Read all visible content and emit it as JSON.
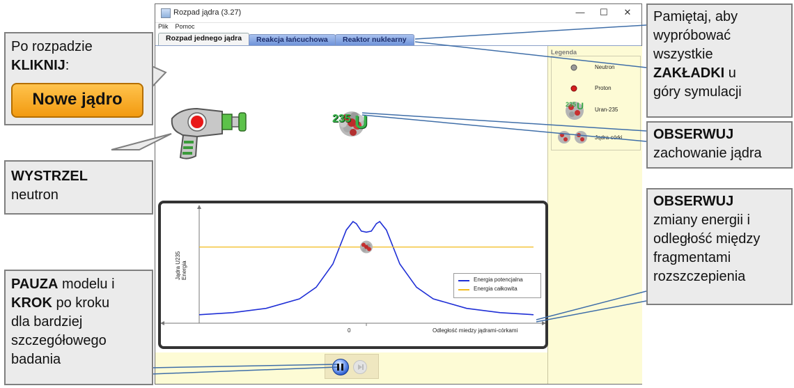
{
  "window": {
    "title": "Rozpad jądra (3.27)",
    "minimize": "—",
    "maximize": "☐",
    "close": "✕"
  },
  "menu": [
    "Plik",
    "Pomoc"
  ],
  "tabs": [
    {
      "label": "Rozpad jednego jądra",
      "active": true
    },
    {
      "label": "Reakcja łańcuchowa",
      "active": false
    },
    {
      "label": "Reaktor nuklearny",
      "active": false
    }
  ],
  "legend": {
    "title": "Legenda",
    "items": [
      {
        "label": "Neutron",
        "icon": "neutron-icon"
      },
      {
        "label": "Proton",
        "icon": "proton-icon"
      },
      {
        "label": "Uran-235",
        "icon": "uranium-icon"
      },
      {
        "label": "Jądra-córki",
        "icon": "daughter-nuclei-icon"
      }
    ]
  },
  "nucleus": {
    "label": "235U",
    "number": "235",
    "symbol": "U"
  },
  "chart_data": {
    "type": "line",
    "xlabel": "Odległość miedzy jądrami-córkami",
    "ylabel_line1": "Jądra U235",
    "ylabel_line2": "Energia",
    "xtick": "0",
    "xlim": [
      -1,
      1
    ],
    "ylim": [
      0,
      1
    ],
    "series": [
      {
        "name": "Energia potencjalna",
        "color": "#1f2fd6",
        "x": [
          -1,
          -0.8,
          -0.6,
          -0.4,
          -0.3,
          -0.2,
          -0.12,
          -0.08,
          -0.06,
          -0.03,
          0,
          0.03,
          0.06,
          0.08,
          0.12,
          0.2,
          0.3,
          0.4,
          0.6,
          0.8,
          1
        ],
        "y": [
          0.08,
          0.1,
          0.14,
          0.23,
          0.34,
          0.56,
          0.88,
          0.96,
          0.94,
          0.87,
          0.86,
          0.87,
          0.94,
          0.96,
          0.88,
          0.56,
          0.34,
          0.23,
          0.14,
          0.1,
          0.08
        ]
      },
      {
        "name": "Energia całkowita",
        "color": "#f2bb1c",
        "x": [
          -1,
          1
        ],
        "y": [
          0.72,
          0.72
        ]
      }
    ],
    "legend_position": "right"
  },
  "callouts": {
    "new_nucleus": {
      "line1": "Po rozpadzie",
      "strong": "KLIKNIJ",
      "suffix": ":",
      "button": "Nowe jądro"
    },
    "fire": {
      "strong": "WYSTRZEL",
      "text": "neutron"
    },
    "pause": {
      "strong1": "PAUZA",
      "text1": " modelu i",
      "strong2": "KROK",
      "text2": " po kroku",
      "text3": "dla bardziej",
      "text4": "szczegółowego",
      "text5": "badania"
    },
    "tabs_hint": {
      "text1": "Pamiętaj, aby",
      "text2": "wypróbować",
      "text3": "wszystkie",
      "strong": "ZAKŁADKI",
      "text4": " u",
      "text5": "góry symulacji"
    },
    "observe_nucleus": {
      "strong": "OBSERWUJ",
      "text": "zachowanie jądra"
    },
    "observe_energy": {
      "strong": "OBSERWUJ",
      "text1": "zmiany energii i",
      "text2": "odległość między",
      "text3": "fragmentami",
      "text4": "rozszczepienia"
    }
  }
}
